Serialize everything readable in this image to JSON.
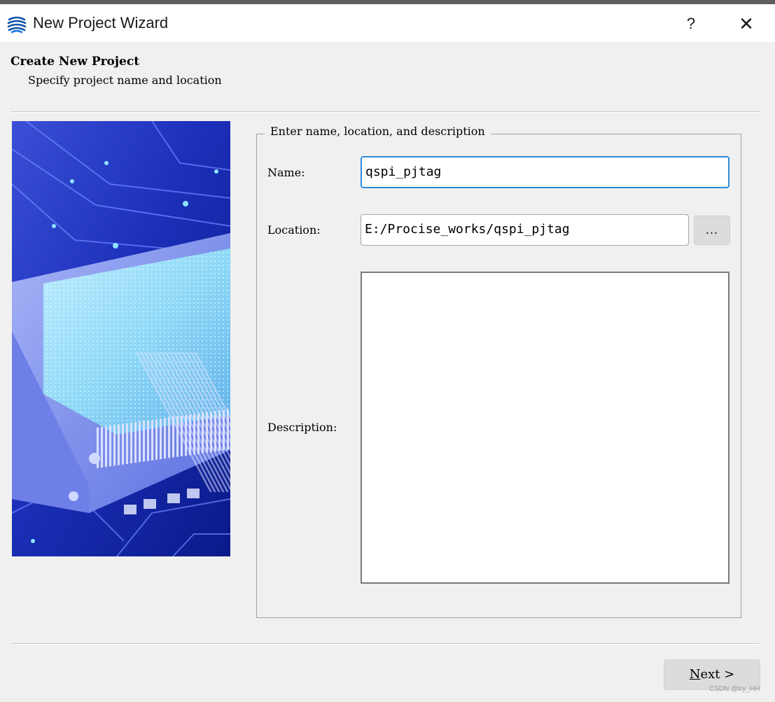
{
  "window": {
    "title": "New Project Wizard",
    "help_label": "?",
    "close_label": "✕"
  },
  "header": {
    "title": "Create New Project",
    "subtitle": "Specify project name and location"
  },
  "form": {
    "group_title": "Enter name, location, and description",
    "name_label": "Name:",
    "name_value": "qspi_pjtag",
    "location_label": "Location:",
    "location_value": "E:/Procise_works/qspi_pjtag",
    "browse_label": "...",
    "description_label": "Description:",
    "description_value": ""
  },
  "footer": {
    "next_mnemonic": "N",
    "next_rest": "ext >"
  },
  "watermark": "CSDN @try_HH",
  "colors": {
    "client_bg": "#f0f0f0",
    "focus_border": "#2d8ad9",
    "button_bg": "#dcdcdc"
  }
}
